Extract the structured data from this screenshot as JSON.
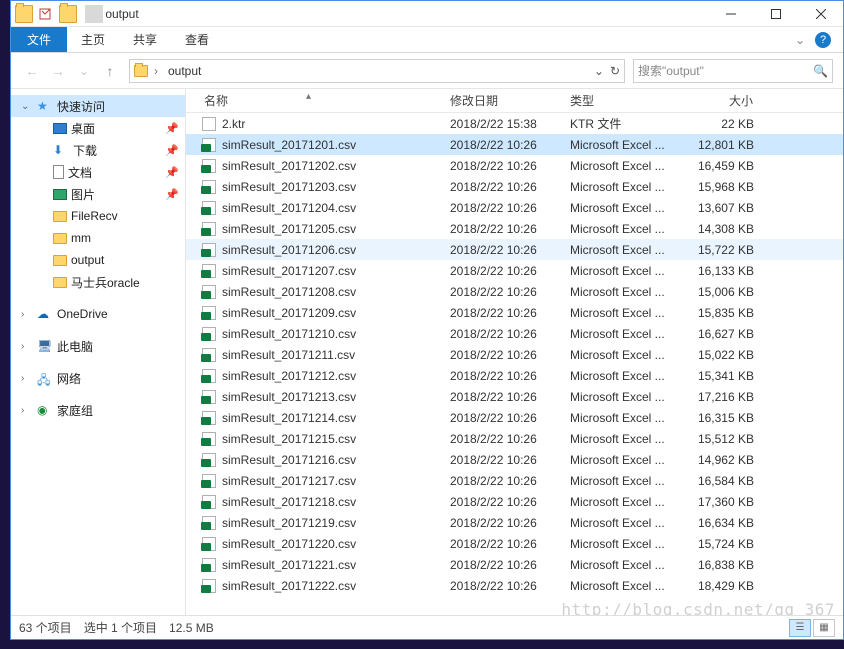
{
  "window": {
    "title": "output"
  },
  "ribbon": {
    "file": "文件",
    "home": "主页",
    "share": "共享",
    "view": "查看"
  },
  "address": {
    "segment": "output",
    "search_placeholder": "搜索\"output\""
  },
  "sidebar": {
    "quick_access": "快速访问",
    "desktop": "桌面",
    "downloads": "下载",
    "documents": "文档",
    "pictures": "图片",
    "filerecv": "FileRecv",
    "mm": "mm",
    "output": "output",
    "msb": "马士兵oracle",
    "onedrive": "OneDrive",
    "thispc": "此电脑",
    "network": "网络",
    "homegroup": "家庭组"
  },
  "columns": {
    "name": "名称",
    "date": "修改日期",
    "type": "类型",
    "size": "大小"
  },
  "files": [
    {
      "name": "2.ktr",
      "date": "2018/2/22 15:38",
      "type": "KTR 文件",
      "size": "22 KB",
      "icon": "ktr",
      "selected": false
    },
    {
      "name": "simResult_20171201.csv",
      "date": "2018/2/22 10:26",
      "type": "Microsoft Excel ...",
      "size": "12,801 KB",
      "icon": "csv",
      "selected": true
    },
    {
      "name": "simResult_20171202.csv",
      "date": "2018/2/22 10:26",
      "type": "Microsoft Excel ...",
      "size": "16,459 KB",
      "icon": "csv"
    },
    {
      "name": "simResult_20171203.csv",
      "date": "2018/2/22 10:26",
      "type": "Microsoft Excel ...",
      "size": "15,968 KB",
      "icon": "csv"
    },
    {
      "name": "simResult_20171204.csv",
      "date": "2018/2/22 10:26",
      "type": "Microsoft Excel ...",
      "size": "13,607 KB",
      "icon": "csv"
    },
    {
      "name": "simResult_20171205.csv",
      "date": "2018/2/22 10:26",
      "type": "Microsoft Excel ...",
      "size": "14,308 KB",
      "icon": "csv"
    },
    {
      "name": "simResult_20171206.csv",
      "date": "2018/2/22 10:26",
      "type": "Microsoft Excel ...",
      "size": "15,722 KB",
      "icon": "csv",
      "secondary": true
    },
    {
      "name": "simResult_20171207.csv",
      "date": "2018/2/22 10:26",
      "type": "Microsoft Excel ...",
      "size": "16,133 KB",
      "icon": "csv"
    },
    {
      "name": "simResult_20171208.csv",
      "date": "2018/2/22 10:26",
      "type": "Microsoft Excel ...",
      "size": "15,006 KB",
      "icon": "csv"
    },
    {
      "name": "simResult_20171209.csv",
      "date": "2018/2/22 10:26",
      "type": "Microsoft Excel ...",
      "size": "15,835 KB",
      "icon": "csv"
    },
    {
      "name": "simResult_20171210.csv",
      "date": "2018/2/22 10:26",
      "type": "Microsoft Excel ...",
      "size": "16,627 KB",
      "icon": "csv"
    },
    {
      "name": "simResult_20171211.csv",
      "date": "2018/2/22 10:26",
      "type": "Microsoft Excel ...",
      "size": "15,022 KB",
      "icon": "csv"
    },
    {
      "name": "simResult_20171212.csv",
      "date": "2018/2/22 10:26",
      "type": "Microsoft Excel ...",
      "size": "15,341 KB",
      "icon": "csv"
    },
    {
      "name": "simResult_20171213.csv",
      "date": "2018/2/22 10:26",
      "type": "Microsoft Excel ...",
      "size": "17,216 KB",
      "icon": "csv"
    },
    {
      "name": "simResult_20171214.csv",
      "date": "2018/2/22 10:26",
      "type": "Microsoft Excel ...",
      "size": "16,315 KB",
      "icon": "csv"
    },
    {
      "name": "simResult_20171215.csv",
      "date": "2018/2/22 10:26",
      "type": "Microsoft Excel ...",
      "size": "15,512 KB",
      "icon": "csv"
    },
    {
      "name": "simResult_20171216.csv",
      "date": "2018/2/22 10:26",
      "type": "Microsoft Excel ...",
      "size": "14,962 KB",
      "icon": "csv"
    },
    {
      "name": "simResult_20171217.csv",
      "date": "2018/2/22 10:26",
      "type": "Microsoft Excel ...",
      "size": "16,584 KB",
      "icon": "csv"
    },
    {
      "name": "simResult_20171218.csv",
      "date": "2018/2/22 10:26",
      "type": "Microsoft Excel ...",
      "size": "17,360 KB",
      "icon": "csv"
    },
    {
      "name": "simResult_20171219.csv",
      "date": "2018/2/22 10:26",
      "type": "Microsoft Excel ...",
      "size": "16,634 KB",
      "icon": "csv"
    },
    {
      "name": "simResult_20171220.csv",
      "date": "2018/2/22 10:26",
      "type": "Microsoft Excel ...",
      "size": "15,724 KB",
      "icon": "csv"
    },
    {
      "name": "simResult_20171221.csv",
      "date": "2018/2/22 10:26",
      "type": "Microsoft Excel ...",
      "size": "16,838 KB",
      "icon": "csv"
    },
    {
      "name": "simResult_20171222.csv",
      "date": "2018/2/22 10:26",
      "type": "Microsoft Excel ...",
      "size": "18,429 KB",
      "icon": "csv"
    }
  ],
  "status": {
    "count": "63 个项目",
    "selection": "选中 1 个项目",
    "size": "12.5 MB"
  },
  "watermark": "http://blog.csdn.net/qq_367"
}
